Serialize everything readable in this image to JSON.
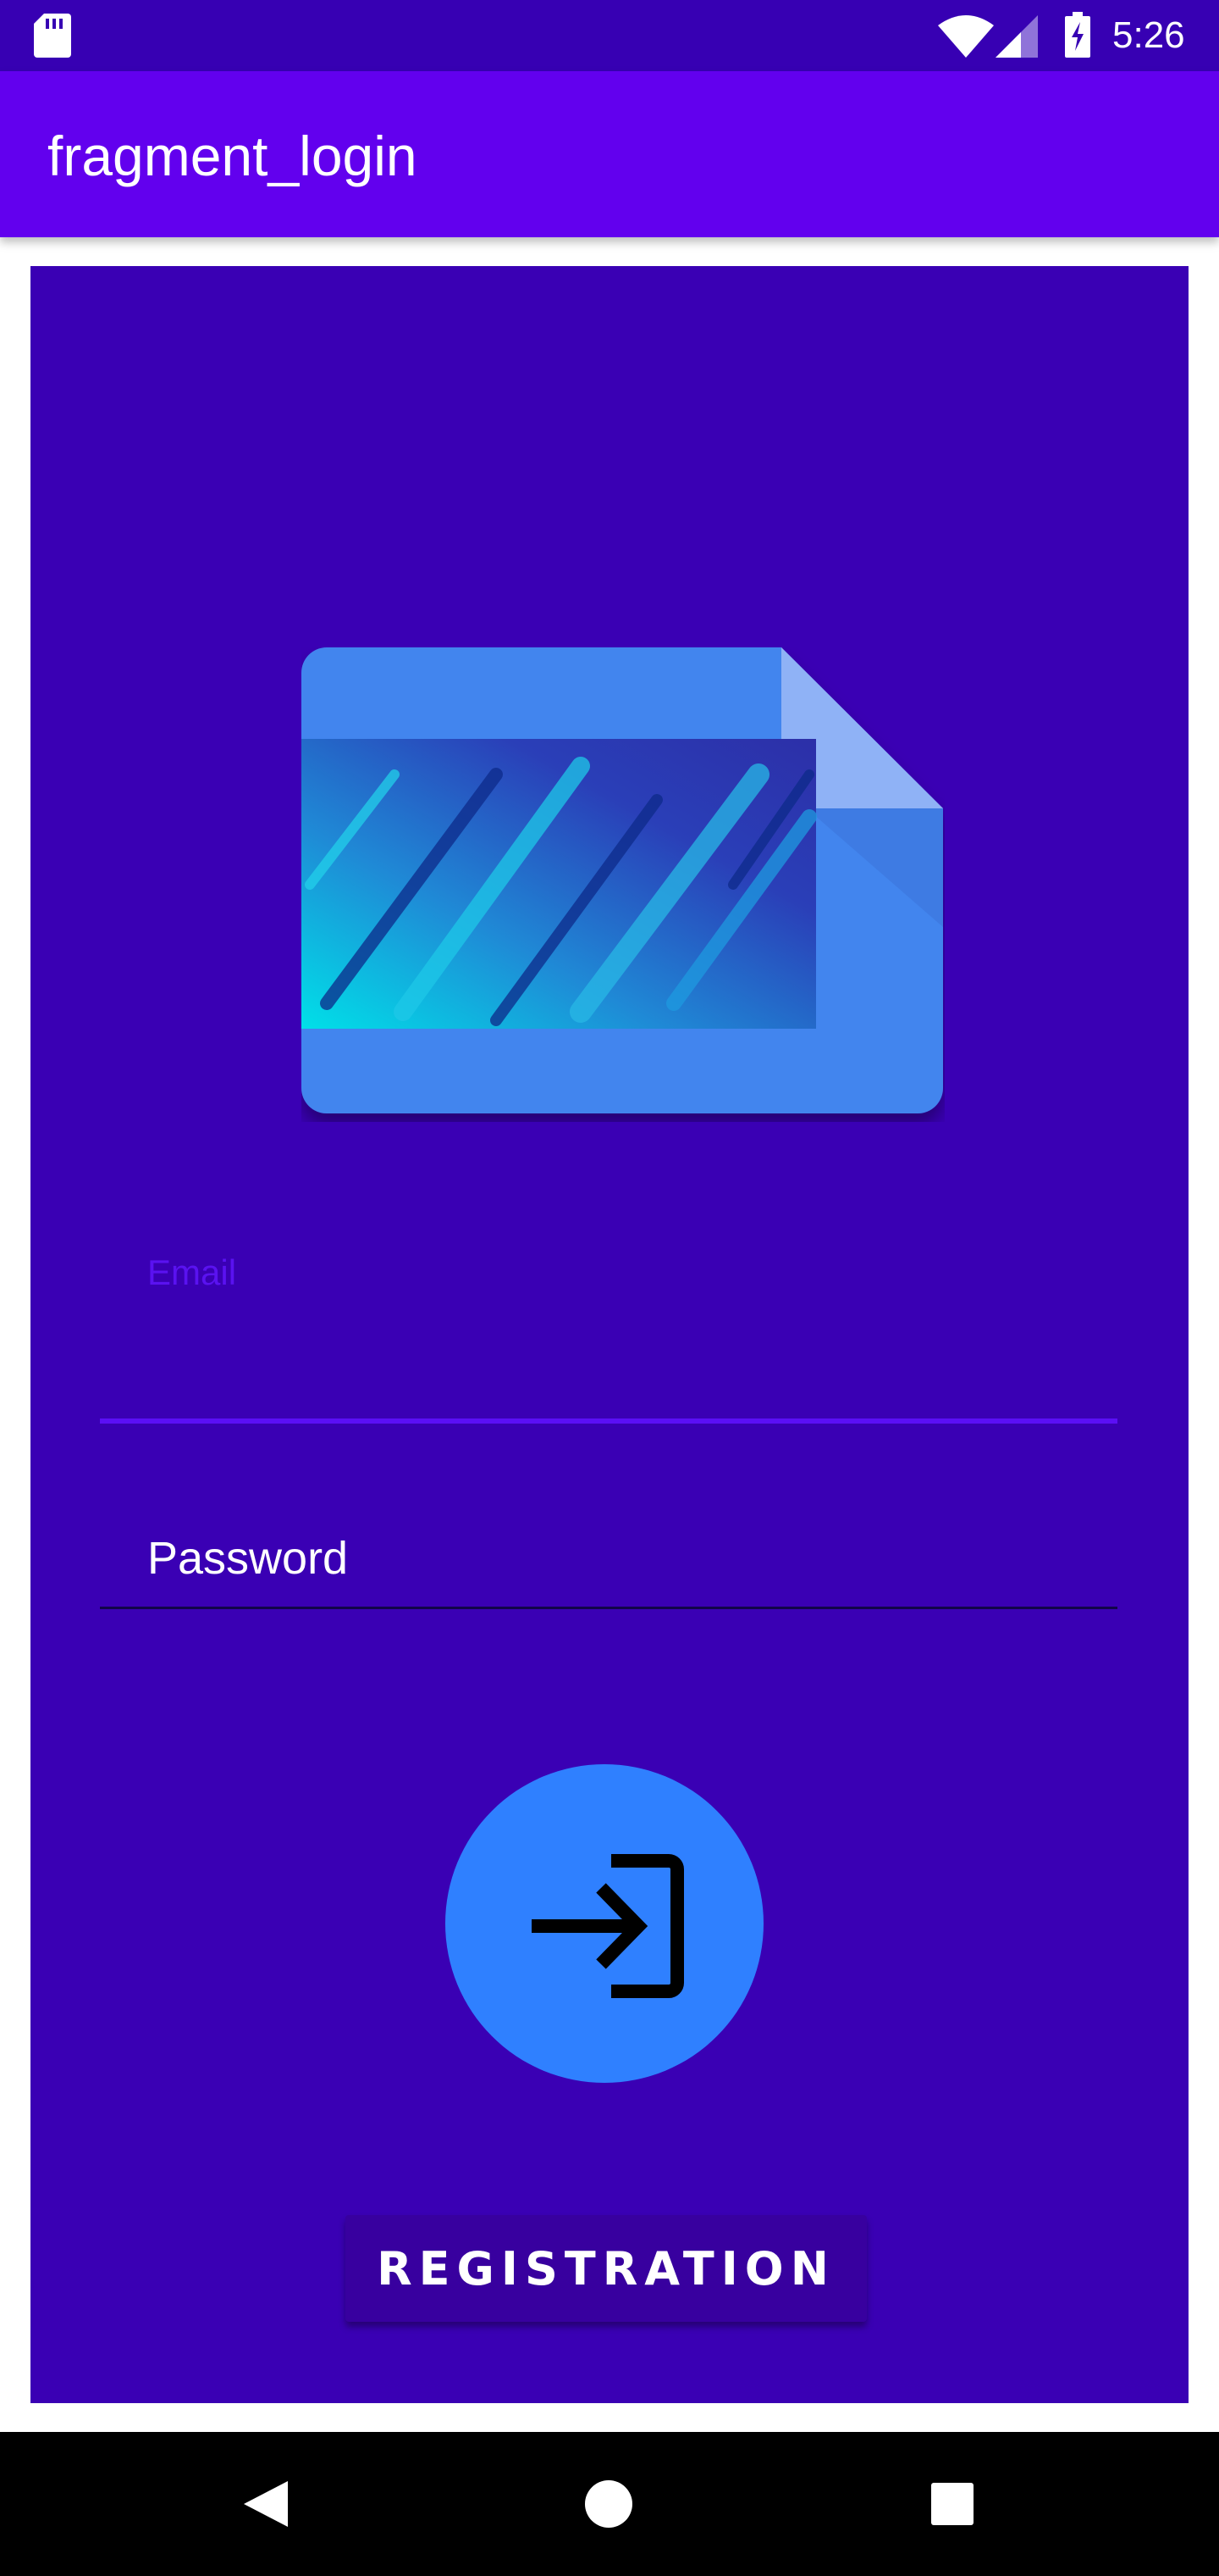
{
  "status_bar": {
    "time": "5:26",
    "icons": [
      "sd-card-icon",
      "wifi-icon",
      "signal-icon",
      "battery-charging-icon"
    ]
  },
  "app_bar": {
    "title": "fragment_login"
  },
  "form": {
    "email_label": "Email",
    "email_value": "",
    "password_placeholder": "Password",
    "password_value": "",
    "login_icon": "login-arrow-icon",
    "register_label": "Registration"
  },
  "nav_bar": {
    "icons": [
      "back-icon",
      "home-icon",
      "recents-icon"
    ]
  },
  "colors": {
    "status_bar": "#3700b3",
    "app_bar": "#6200ee",
    "panel": "#3a00b4",
    "accent": "#5b0ff5",
    "login_button": "#2f80ff"
  }
}
